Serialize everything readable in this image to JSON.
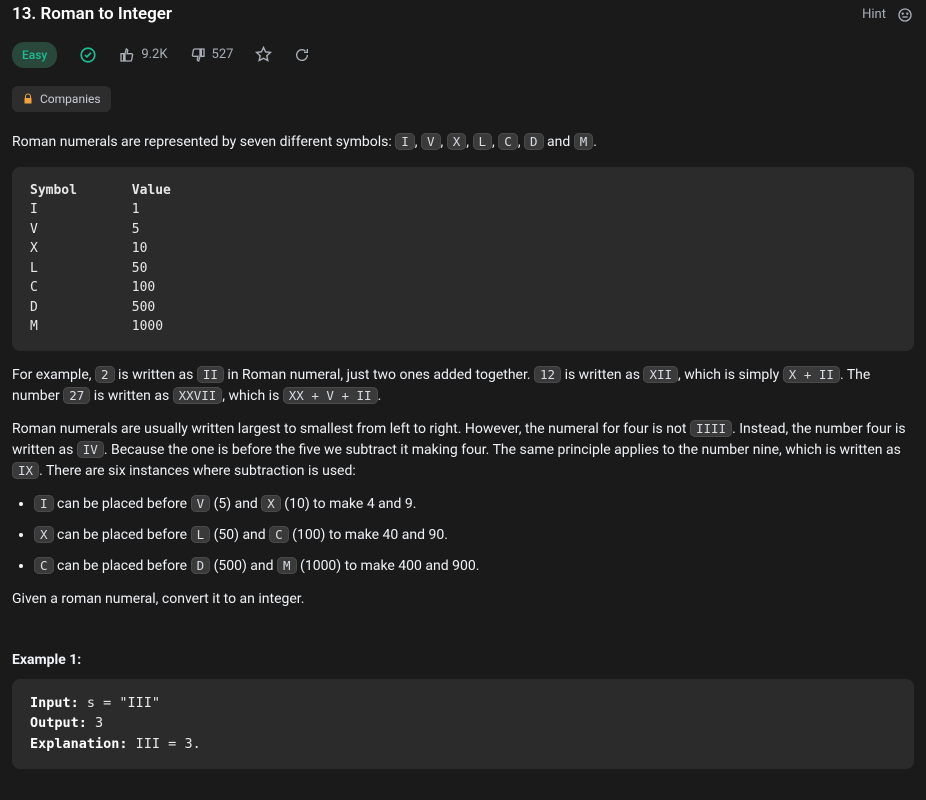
{
  "header": {
    "title": "13. Roman to Integer",
    "hint_label": "Hint"
  },
  "stats": {
    "difficulty": "Easy",
    "likes": "9.2K",
    "dislikes": "527"
  },
  "tags": {
    "companies": "Companies"
  },
  "intro": {
    "pre": "Roman numerals are represented by seven different symbols: ",
    "symbols": [
      "I",
      "V",
      "X",
      "L",
      "C",
      "D",
      "M"
    ],
    "and": " and ",
    "post": "."
  },
  "table": {
    "header_symbol": "Symbol",
    "header_value": "Value",
    "rows": [
      {
        "sym": "I",
        "val": "1"
      },
      {
        "sym": "V",
        "val": "5"
      },
      {
        "sym": "X",
        "val": "10"
      },
      {
        "sym": "L",
        "val": "50"
      },
      {
        "sym": "C",
        "val": "100"
      },
      {
        "sym": "D",
        "val": "500"
      },
      {
        "sym": "M",
        "val": "1000"
      }
    ]
  },
  "para_example": {
    "t0": "For example, ",
    "c0": "2",
    "t1": " is written as ",
    "c1": "II",
    "t2": " in Roman numeral, just two ones added together. ",
    "c2": "12",
    "t3": " is written as ",
    "c3": "XII",
    "t4": ", which is simply ",
    "c4": "X + II",
    "t5": ". The number ",
    "c5": "27",
    "t6": " is written as ",
    "c6": "XXVII",
    "t7": ", which is ",
    "c7": "XX + V + II",
    "t8": "."
  },
  "para_sub": {
    "t0": "Roman numerals are usually written largest to smallest from left to right. However, the numeral for four is not ",
    "c0": "IIII",
    "t1": ". Instead, the number four is written as ",
    "c1": "IV",
    "t2": ". Because the one is before the five we subtract it making four. The same principle applies to the number nine, which is written as ",
    "c2": "IX",
    "t3": ". There are six instances where subtraction is used:"
  },
  "rules": [
    {
      "c0": "I",
      "t0": " can be placed before ",
      "c1": "V",
      "t1": " (5) and ",
      "c2": "X",
      "t2": " (10) to make 4 and 9."
    },
    {
      "c0": "X",
      "t0": " can be placed before ",
      "c1": "L",
      "t1": " (50) and ",
      "c2": "C",
      "t2": " (100) to make 40 and 90."
    },
    {
      "c0": "C",
      "t0": " can be placed before ",
      "c1": "D",
      "t1": " (500) and ",
      "c2": "M",
      "t2": " (1000) to make 400 and 900."
    }
  ],
  "task": "Given a roman numeral, convert it to an integer.",
  "example": {
    "label": "Example 1:",
    "input_k": "Input:",
    "input_v": " s = \"III\"",
    "output_k": "Output:",
    "output_v": " 3",
    "expl_k": "Explanation:",
    "expl_v": " III = 3."
  }
}
